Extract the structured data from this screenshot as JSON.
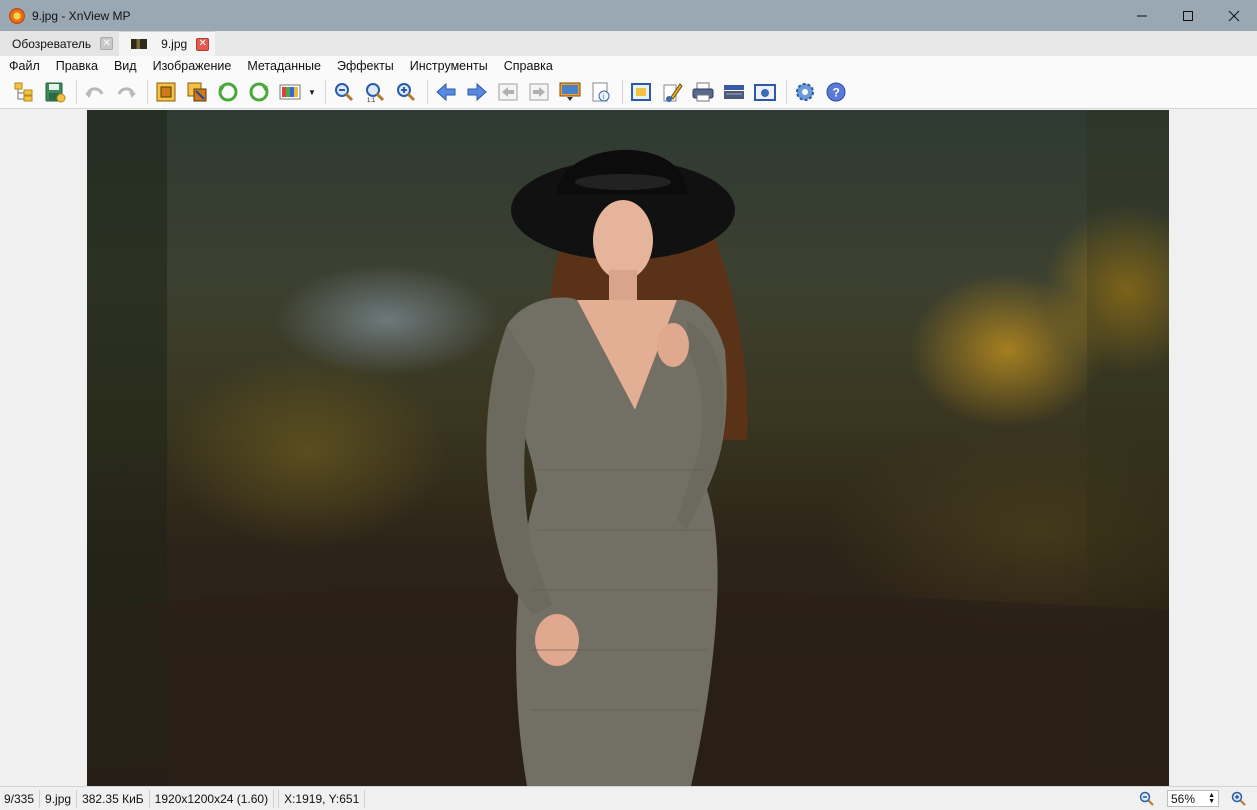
{
  "window": {
    "title": "9.jpg - XnView MP"
  },
  "tabs": [
    {
      "label": "Обозреватель",
      "active": false
    },
    {
      "label": "9.jpg",
      "active": true
    }
  ],
  "menu": [
    "Файл",
    "Правка",
    "Вид",
    "Изображение",
    "Метаданные",
    "Эффекты",
    "Инструменты",
    "Справка"
  ],
  "toolbar": {
    "icons": [
      "open-browser-icon",
      "save-icon",
      "undo-icon",
      "redo-icon",
      "crop-icon",
      "resize-icon",
      "rotate-left-icon",
      "rotate-right-icon",
      "color-adjust-icon",
      "zoom-out-icon",
      "zoom-fit-icon",
      "zoom-in-icon",
      "previous-icon",
      "next-icon",
      "first-icon",
      "last-icon",
      "slideshow-icon",
      "info-icon",
      "fullscreen-icon",
      "edit-icon",
      "print-icon",
      "scanner-icon",
      "screenshot-icon",
      "settings-icon",
      "help-icon"
    ]
  },
  "status": {
    "index": "9/335",
    "filename": "9.jpg",
    "filesize": "382.35 КиБ",
    "dimensions": "1920x1200x24 (1.60)",
    "cursor": "X:1919, Y:651",
    "zoom": "56%"
  },
  "colors": {
    "titlebar": "#9aa8b4",
    "tab_close_active": "#e05a4e"
  }
}
